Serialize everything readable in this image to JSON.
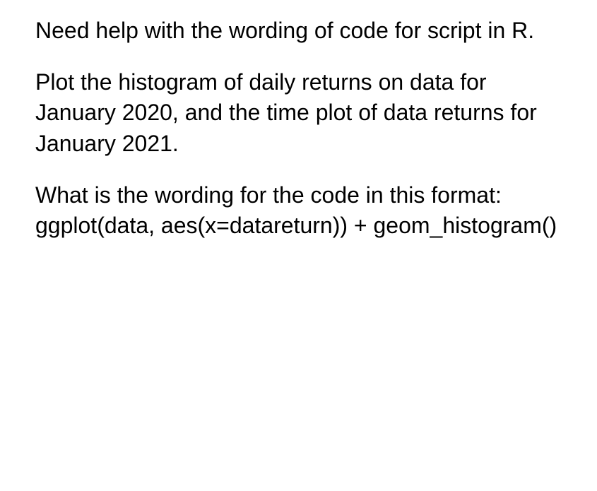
{
  "paragraphs": {
    "p1": "Need help with the wording of code for script in R.",
    "p2": "Plot the histogram of daily returns on data for January 2020, and the time plot of data returns for January 2021.",
    "p3": "What is the wording for the code in this format: ggplot(data, aes(x=datareturn)) + geom_histogram()"
  }
}
